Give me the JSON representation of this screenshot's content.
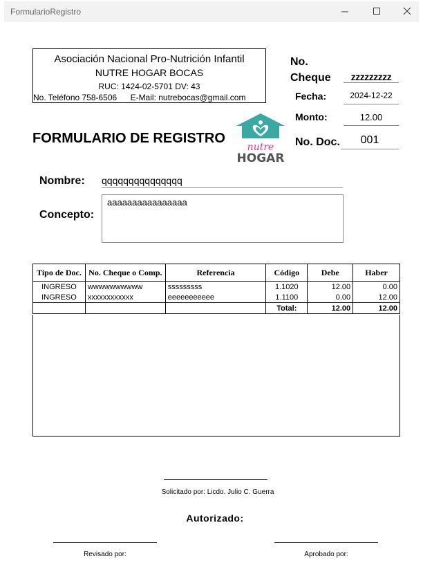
{
  "window": {
    "title": "FormularioRegistro"
  },
  "organization": {
    "name": "Asociación Nacional Pro-Nutrición Infantil",
    "branch": "NUTRE HOGAR BOCAS",
    "ruc": "RUC: 1424-02-5701 DV: 43",
    "phone": "No. Teléfono 758-6506",
    "email": "E-Mail: nutrebocas@gmail.com"
  },
  "cheque": {
    "label_line1": "No.",
    "label_line2": "Cheque",
    "value": "zzzzzzzzz"
  },
  "fecha": {
    "label": "Fecha:",
    "value": "2024-12-22"
  },
  "monto": {
    "label": "Monto:",
    "value": "12.00"
  },
  "nodoc": {
    "label": "No. Doc.",
    "value": "001"
  },
  "form_title": "FORMULARIO DE REGISTRO",
  "logo": {
    "word1": "nutre",
    "word2": "HOGAR",
    "teal": "#3aa9a4",
    "pink": "#e0348a",
    "gray": "#555555"
  },
  "nombre": {
    "label": "Nombre:",
    "value": "qqqqqqqqqqqqqqq"
  },
  "concepto": {
    "label": "Concepto:",
    "value": "aaaaaaaaaaaaaaaa"
  },
  "table": {
    "headers": [
      "Tipo de Doc.",
      "No. Cheque o Comp.",
      "Referencia",
      "Código",
      "Debe",
      "Haber"
    ],
    "rows": [
      {
        "tipo": "INGRESO",
        "cheque": "wwwwwwwwww",
        "referencia": "sssssssss",
        "codigo": "1.1020",
        "debe": "12.00",
        "haber": "0.00"
      },
      {
        "tipo": "INGRESO",
        "cheque": "xxxxxxxxxxxx",
        "referencia": "eeeeeeeeeee",
        "codigo": "1.1100",
        "debe": "0.00",
        "haber": "12.00"
      }
    ],
    "total_label": "Total:",
    "total_debe": "12.00",
    "total_haber": "12.00"
  },
  "signatures": {
    "solicitado": "Solicitado por: Licdo. Julio C. Guerra",
    "autorizado": "Autorizado:",
    "revisado": "Revisado por:",
    "aprobado": "Aprobado por:"
  }
}
